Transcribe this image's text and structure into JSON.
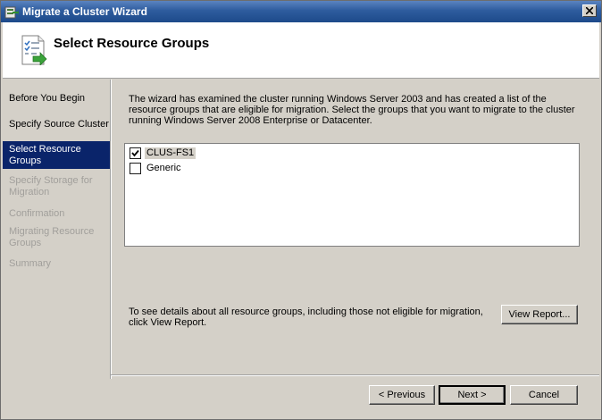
{
  "window": {
    "title": "Migrate a Cluster Wizard",
    "close_glyph": "X"
  },
  "header": {
    "title": "Select Resource Groups",
    "icon": "checklist-arrow-icon"
  },
  "sidebar": {
    "items": [
      {
        "label": "Before You Begin",
        "state": "enabled"
      },
      {
        "label": "Specify Source Cluster",
        "state": "enabled"
      },
      {
        "label": "Select Resource\nGroups",
        "state": "active"
      },
      {
        "label": "Specify Storage for\nMigration",
        "state": "disabled"
      },
      {
        "label": "Confirmation",
        "state": "disabled"
      },
      {
        "label": "Migrating Resource\nGroups",
        "state": "disabled"
      },
      {
        "label": "Summary",
        "state": "disabled"
      }
    ]
  },
  "main": {
    "description": "The wizard has examined the cluster running Windows Server 2003 and has created a list of the resource groups that are eligible for migration. Select the groups that you want to migrate to the cluster running Windows Server 2008 Enterprise or Datacenter.",
    "groups": [
      {
        "name": "CLUS-FS1",
        "checked": true,
        "selected": true
      },
      {
        "name": "Generic",
        "checked": false,
        "selected": false
      }
    ],
    "details_text": "To see details about all resource groups, including those not eligible for migration, click View Report.",
    "view_report_label": "View Report..."
  },
  "footer": {
    "previous_label": "< Previous",
    "next_label": "Next >",
    "cancel_label": "Cancel"
  },
  "colors": {
    "titlebar": "#2e5c9e",
    "face": "#d4d0c8",
    "selection": "#0a246a",
    "disabled_text": "#a19f9b"
  }
}
